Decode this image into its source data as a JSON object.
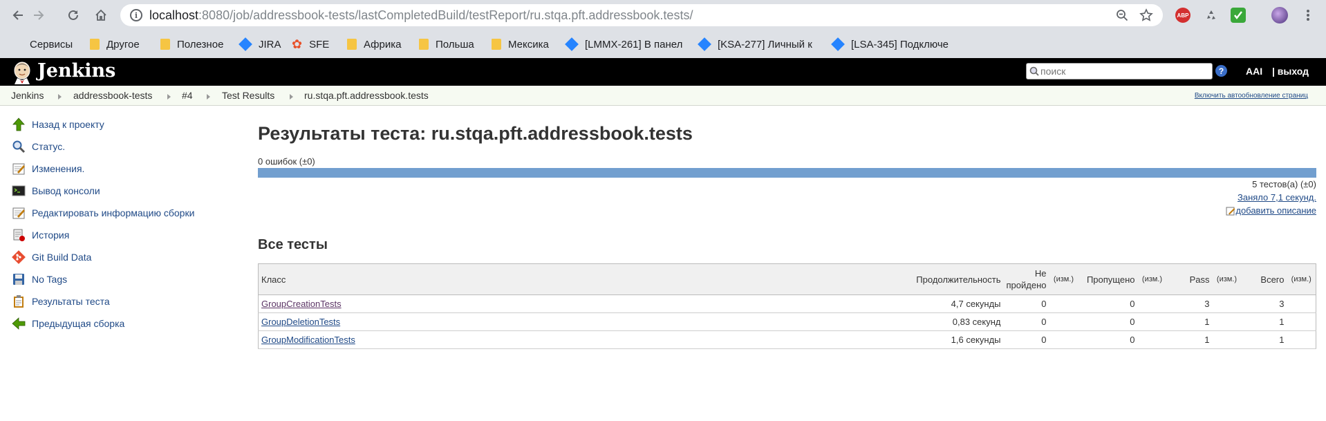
{
  "browser": {
    "url_host": "localhost",
    "url_path": ":8080/job/addressbook-tests/lastCompletedBuild/testReport/ru.stqa.pft.addressbook.tests/",
    "extensions": {
      "abp_label": "ABP"
    },
    "bookmarks": [
      {
        "label": "Сервисы",
        "icon": "apps-grid-icon"
      },
      {
        "label": "Другое",
        "icon": "folder-icon"
      },
      {
        "label": "Полезное",
        "icon": "folder-icon"
      },
      {
        "label": "JIRA",
        "icon": "jira-icon"
      },
      {
        "label": "SFE",
        "icon": "sfe-icon"
      },
      {
        "label": "Африка",
        "icon": "folder-icon"
      },
      {
        "label": "Польша",
        "icon": "folder-icon"
      },
      {
        "label": "Мексика",
        "icon": "folder-icon"
      },
      {
        "label": "[LMMX-261] В панел",
        "icon": "jira-icon"
      },
      {
        "label": "[KSA-277] Личный к",
        "icon": "jira-icon"
      },
      {
        "label": "[LSA-345] Подключе",
        "icon": "jira-icon"
      }
    ]
  },
  "header": {
    "title": "Jenkins",
    "search_placeholder": "поиск",
    "help": "?",
    "user": "AAI",
    "logout": "| выход"
  },
  "breadcrumbs": [
    "Jenkins",
    "addressbook-tests",
    "#4",
    "Test Results",
    "ru.stqa.pft.addressbook.tests"
  ],
  "autorefresh": "Включить автообновление страниц",
  "sidebar": {
    "items": [
      {
        "label": "Назад к проекту",
        "icon": "up-arrow-icon"
      },
      {
        "label": "Статус.",
        "icon": "magnifier-icon"
      },
      {
        "label": "Изменения.",
        "icon": "notepad-icon"
      },
      {
        "label": "Вывод консоли",
        "icon": "terminal-icon"
      },
      {
        "label": "Редактировать информацию сборки",
        "icon": "notepad-icon"
      },
      {
        "label": "История",
        "icon": "history-icon"
      },
      {
        "label": "Git Build Data",
        "icon": "git-icon"
      },
      {
        "label": "No Tags",
        "icon": "save-icon"
      },
      {
        "label": "Результаты теста",
        "icon": "clipboard-icon"
      },
      {
        "label": "Предыдущая сборка",
        "icon": "left-arrow-icon"
      }
    ]
  },
  "main": {
    "title": "Результаты теста: ru.stqa.pft.addressbook.tests",
    "failures": "0 ошибок (±0)",
    "failure_fraction": 0,
    "tests_count": "5 тестов(а) (±0)",
    "duration": "Заняло 7,1 секунд.",
    "add_description": "добавить описание",
    "section_title": "Все тесты",
    "table": {
      "headers": {
        "class": "Класс",
        "duration": "Продолжительность",
        "failed_line1": "Не",
        "failed_line2": "пройдено",
        "failed_diff": "(изм.)",
        "skipped": "Пропущено",
        "skipped_diff": "(изм.)",
        "pass": "Pass",
        "pass_diff": "(изм.)",
        "total": "Всего",
        "total_diff": "(изм.)"
      },
      "rows": [
        {
          "class": "GroupCreationTests",
          "duration": "4,7 секунды",
          "failed": "0",
          "skipped": "0",
          "pass": "3",
          "total": "3"
        },
        {
          "class": "GroupDeletionTests",
          "duration": "0,83 секунд",
          "failed": "0",
          "skipped": "0",
          "pass": "1",
          "total": "1"
        },
        {
          "class": "GroupModificationTests",
          "duration": "1,6 секунды",
          "failed": "0",
          "skipped": "0",
          "pass": "1",
          "total": "1"
        }
      ]
    }
  },
  "colors": {
    "jenkins_header": "#000000",
    "progress_pass": "#729fcf",
    "link": "#204a87",
    "chrome_bg": "#dee1e6"
  }
}
